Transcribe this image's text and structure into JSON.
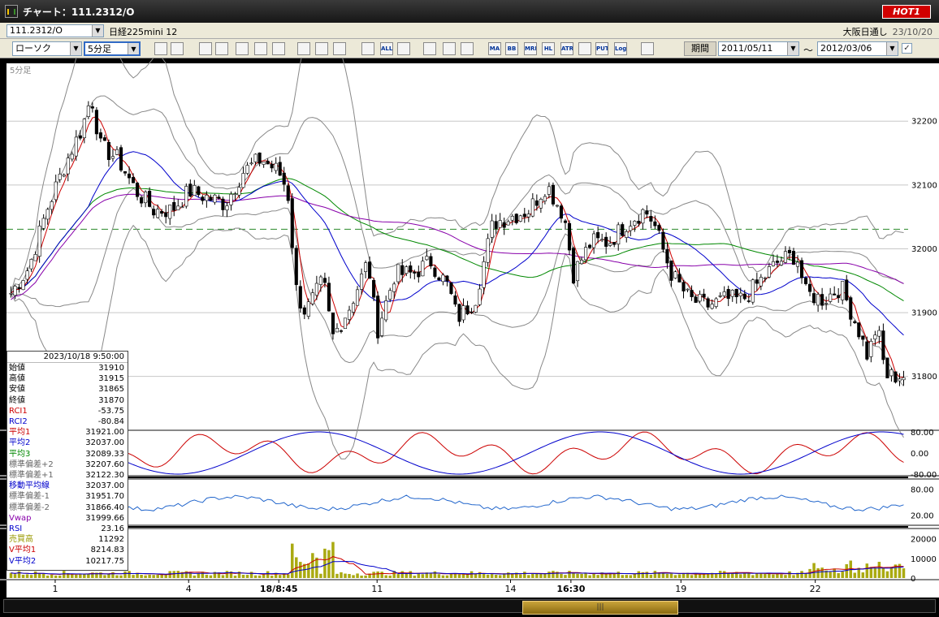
{
  "window": {
    "title": "チャート：111.2312/O",
    "hot_label": "HOT1"
  },
  "symbol_bar": {
    "symbol": "111.2312/O",
    "name": "日経225mini 12",
    "exchange": "大阪日通し",
    "date": "23/10/20"
  },
  "toolbar": {
    "chart_type": "ローソク",
    "interval": "5分足",
    "period_button": "期間",
    "from_date": "2011/05/11",
    "tilde": "〜",
    "to_date": "2012/03/06",
    "icons": [
      "search-icon",
      "grid-icon",
      "download-icon",
      "grid2-icon",
      "line-tool-icon",
      "eraser-icon",
      "pen-icon",
      "cursor-icon",
      "undo-icon",
      "prev-bar-icon",
      "next-bar-icon",
      "all-icon",
      "settings-icon",
      "wrench-icon",
      "color-icon",
      "vol-icon",
      "ma-icon",
      "bb-icon",
      "mre-icon",
      "hl-icon",
      "atr-icon",
      "oscillator-icon",
      "put-icon",
      "log-icon",
      "save-icon"
    ],
    "icon_texts": {
      "all": "ALL",
      "ma": "MA",
      "bb": "BB",
      "mre": "MRE",
      "hl": "HL",
      "atr": "ATR",
      "put": "PUT",
      "log": "Log"
    }
  },
  "chart_data": {
    "type": "candlestick",
    "interval_label": "5分足",
    "y_ticks": [
      32200,
      32100,
      32000,
      31900,
      31800
    ],
    "ylim": [
      31715,
      32290
    ],
    "x_labels": [
      {
        "label": "1",
        "bold": false,
        "xf": 0.054
      },
      {
        "label": "4",
        "bold": false,
        "xf": 0.202
      },
      {
        "label": "18/8:45",
        "bold": true,
        "xf": 0.302
      },
      {
        "label": "11",
        "bold": false,
        "xf": 0.411
      },
      {
        "label": "14",
        "bold": false,
        "xf": 0.559
      },
      {
        "label": "16:30",
        "bold": true,
        "xf": 0.626
      },
      {
        "label": "19",
        "bold": false,
        "xf": 0.748
      },
      {
        "label": "22",
        "bold": false,
        "xf": 0.897
      }
    ],
    "ref_level": 32030,
    "series": {
      "close_path": [
        [
          0,
          31930
        ],
        [
          0.02,
          31970
        ],
        [
          0.04,
          32060
        ],
        [
          0.06,
          32130
        ],
        [
          0.08,
          32190
        ],
        [
          0.09,
          32240
        ],
        [
          0.1,
          32160
        ],
        [
          0.12,
          32140
        ],
        [
          0.14,
          32090
        ],
        [
          0.16,
          32060
        ],
        [
          0.18,
          32060
        ],
        [
          0.2,
          32090
        ],
        [
          0.22,
          32080
        ],
        [
          0.24,
          32070
        ],
        [
          0.26,
          32120
        ],
        [
          0.28,
          32140
        ],
        [
          0.3,
          32120
        ],
        [
          0.31,
          32090
        ],
        [
          0.32,
          31930
        ],
        [
          0.33,
          31900
        ],
        [
          0.35,
          31950
        ],
        [
          0.36,
          31860
        ],
        [
          0.38,
          31910
        ],
        [
          0.4,
          31980
        ],
        [
          0.41,
          31870
        ],
        [
          0.43,
          31960
        ],
        [
          0.45,
          31960
        ],
        [
          0.47,
          31980
        ],
        [
          0.49,
          31940
        ],
        [
          0.5,
          31890
        ],
        [
          0.52,
          31920
        ],
        [
          0.54,
          32040
        ],
        [
          0.56,
          32050
        ],
        [
          0.58,
          32060
        ],
        [
          0.6,
          32100
        ],
        [
          0.62,
          32050
        ],
        [
          0.63,
          31960
        ],
        [
          0.65,
          32010
        ],
        [
          0.67,
          32010
        ],
        [
          0.69,
          32040
        ],
        [
          0.71,
          32060
        ],
        [
          0.72,
          32040
        ],
        [
          0.74,
          31960
        ],
        [
          0.76,
          31920
        ],
        [
          0.78,
          31910
        ],
        [
          0.8,
          31920
        ],
        [
          0.82,
          31920
        ],
        [
          0.84,
          31950
        ],
        [
          0.86,
          31980
        ],
        [
          0.88,
          31990
        ],
        [
          0.89,
          31930
        ],
        [
          0.91,
          31920
        ],
        [
          0.93,
          31940
        ],
        [
          0.95,
          31870
        ],
        [
          0.96,
          31830
        ],
        [
          0.97,
          31880
        ],
        [
          0.98,
          31800
        ],
        [
          1.0,
          31800
        ]
      ]
    }
  },
  "panels": {
    "rci": {
      "ticks": [
        "80.00",
        "0.00",
        "-80.00"
      ]
    },
    "rsi": {
      "ticks": [
        "80.00",
        "20.00"
      ]
    },
    "volume": {
      "ticks": [
        "20000",
        "10000",
        "0"
      ]
    }
  },
  "databox": {
    "datetime": "2023/10/18 9:50:00",
    "rows": [
      {
        "label": "始値",
        "value": "31910",
        "color": "#000000"
      },
      {
        "label": "高値",
        "value": "31915",
        "color": "#000000"
      },
      {
        "label": "安値",
        "value": "31865",
        "color": "#000000"
      },
      {
        "label": "終値",
        "value": "31870",
        "color": "#000000"
      },
      {
        "label": "RCI1",
        "value": "-53.75",
        "color": "#cc0000"
      },
      {
        "label": "RCI2",
        "value": "-80.84",
        "color": "#0000cc"
      },
      {
        "label": "平均1",
        "value": "31921.00",
        "color": "#cc0000"
      },
      {
        "label": "平均2",
        "value": "32037.00",
        "color": "#0000cc"
      },
      {
        "label": "平均3",
        "value": "32089.33",
        "color": "#008800"
      },
      {
        "label": "標準偏差+2",
        "value": "32207.60",
        "color": "#666666"
      },
      {
        "label": "標準偏差+1",
        "value": "32122.30",
        "color": "#666666"
      },
      {
        "label": "移動平均線",
        "value": "32037.00",
        "color": "#0000cc"
      },
      {
        "label": "標準偏差-1",
        "value": "31951.70",
        "color": "#666666"
      },
      {
        "label": "標準偏差-2",
        "value": "31866.40",
        "color": "#666666"
      },
      {
        "label": "Vwap",
        "value": "31999.66",
        "color": "#8800aa"
      },
      {
        "label": "RSI",
        "value": "23.16",
        "color": "#0000cc"
      },
      {
        "label": "売買高",
        "value": "11292",
        "color": "#999900"
      },
      {
        "label": "V平均1",
        "value": "8214.83",
        "color": "#cc0000"
      },
      {
        "label": "V平均2",
        "value": "10217.75",
        "color": "#0000cc"
      }
    ]
  },
  "colors": {
    "candle_up": "#ffffff",
    "candle_down": "#000000",
    "ma1": "#cc0000",
    "ma2": "#0000cc",
    "ma3": "#008800",
    "vwap": "#8800aa",
    "bands": "#888888",
    "rci1": "#cc0000",
    "rci2": "#0000cc",
    "rsi": "#2266cc",
    "volume": "#aaaa11"
  }
}
